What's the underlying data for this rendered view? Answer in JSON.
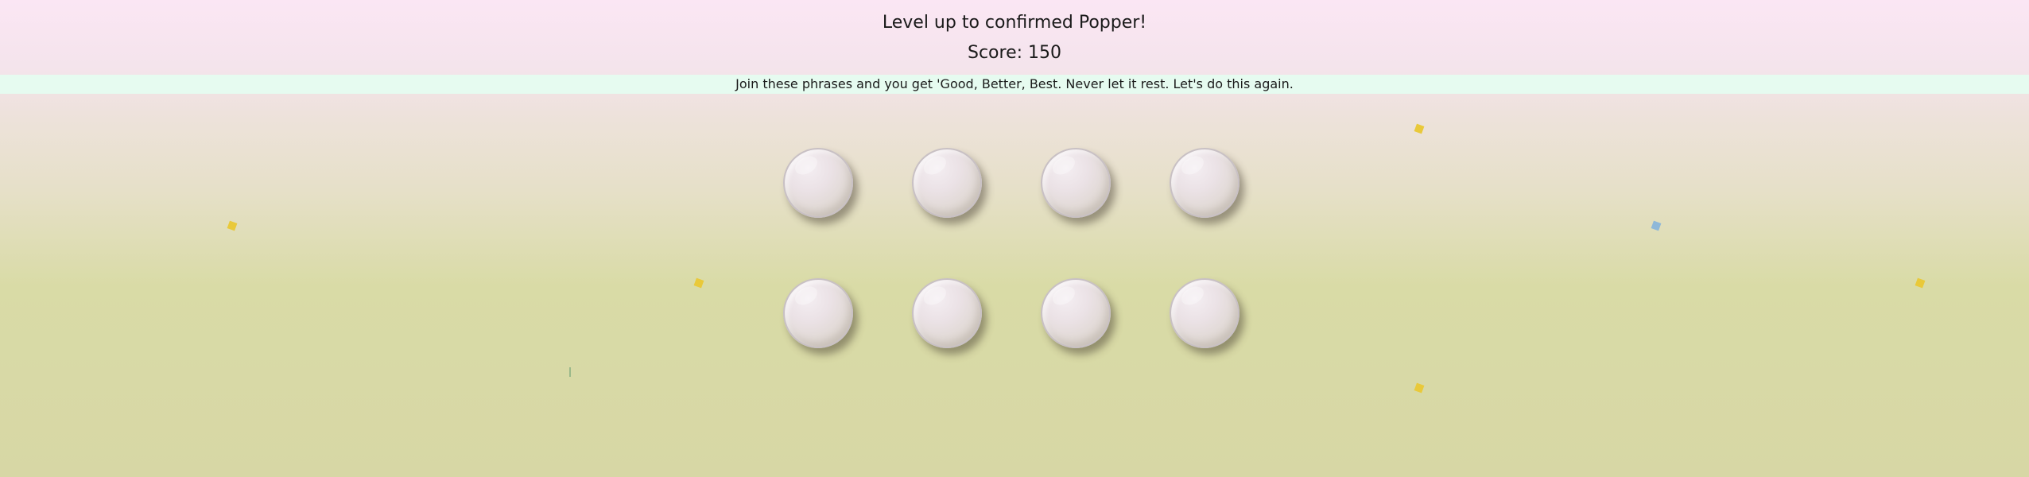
{
  "header": {
    "title": "Level up to confirmed Popper!",
    "score": "Score: 150"
  },
  "banner": {
    "text": "Join these phrases and you get 'Good, Better, Best. Never let it rest. Let's do this again."
  },
  "board": {
    "rows": 2,
    "columns": 4,
    "bubbles": [
      {
        "state": "unpopped"
      },
      {
        "state": "unpopped"
      },
      {
        "state": "unpopped"
      },
      {
        "state": "unpopped"
      },
      {
        "state": "unpopped"
      },
      {
        "state": "unpopped"
      },
      {
        "state": "unpopped"
      },
      {
        "state": "unpopped"
      }
    ]
  },
  "colors": {
    "banner_background": "#e6fbf0",
    "confetti_yellow": "#e9c93a",
    "confetti_blue": "#8fb8d8",
    "confetti_green": "#9ab88a"
  }
}
